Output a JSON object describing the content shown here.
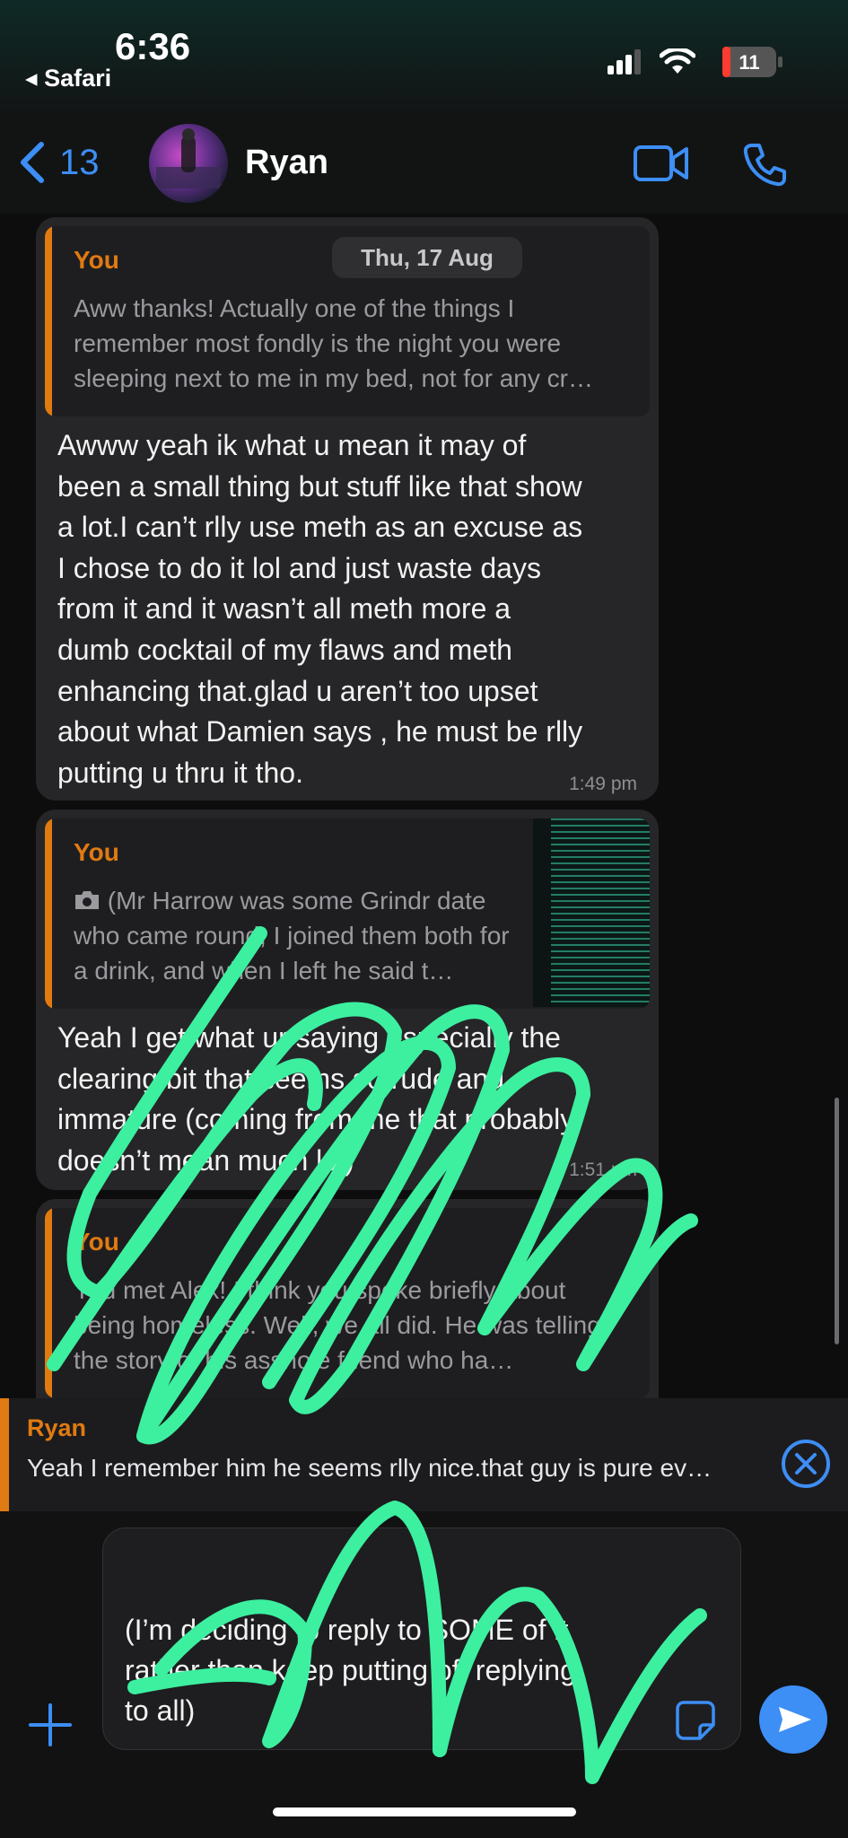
{
  "status_bar": {
    "time": "6:36",
    "back_app": "Safari",
    "battery": "11"
  },
  "nav": {
    "back_count": "13",
    "contact_name": "Ryan"
  },
  "chat": {
    "date_separator": "Thu, 17 Aug",
    "messages": [
      {
        "quote_author": "You",
        "quote_text": "Aww thanks! Actually one of the things I remember most fondly is the night you were sleeping next to me in my bed, not for any cr…",
        "lines": [
          "Awww yeah ik what u mean it may of",
          "been a small thing but stuff like that show",
          "a lot.I can’t rlly use meth as an excuse as",
          "I chose to do it lol and just waste days",
          "from it and it wasn’t all meth more a",
          "dumb cocktail of my flaws and meth",
          "enhancing that.glad u aren’t too upset",
          "about what Damien says , he must be rlly",
          "putting u thru it tho."
        ],
        "time": "1:49 pm"
      },
      {
        "quote_author": "You",
        "quote_icon": "camera-icon",
        "quote_text": "(Mr Harrow was some Grindr date who came round, I joined them both for a drink, and when I left he said t…",
        "lines": [
          "Yeah I get what ur saying especially the",
          "clearing bit that seems so rude and",
          "immature (coming from me that probably",
          "doesn’t mean much lol)"
        ],
        "time": "1:51 pm"
      },
      {
        "quote_author": "You",
        "quote_text": "You met Alex! I think you spoke briefly about being homeless. Well, we all did. He was telling the story of his asshole friend who ha…"
      }
    ]
  },
  "reply_preview": {
    "author": "Ryan",
    "text": "Yeah I remember him he seems rlly nice.that guy is pure ev…"
  },
  "composer": {
    "lines": [
      "(I’m deciding to reply to SOME of it",
      "rather than keep putting off replying",
      "to all)"
    ]
  },
  "colors": {
    "accent_blue": "#3d8ef5",
    "quote_orange": "#e07a12",
    "scribble_green": "#3cf0a0",
    "bubble_bg": "#262628"
  },
  "icons": [
    "back-chevron-icon",
    "video-call-icon",
    "phone-icon",
    "camera-icon",
    "chevron-down-circle-icon",
    "close-circle-icon",
    "plus-icon",
    "sticker-icon",
    "send-icon",
    "signal-icon",
    "wifi-icon",
    "battery-icon"
  ]
}
